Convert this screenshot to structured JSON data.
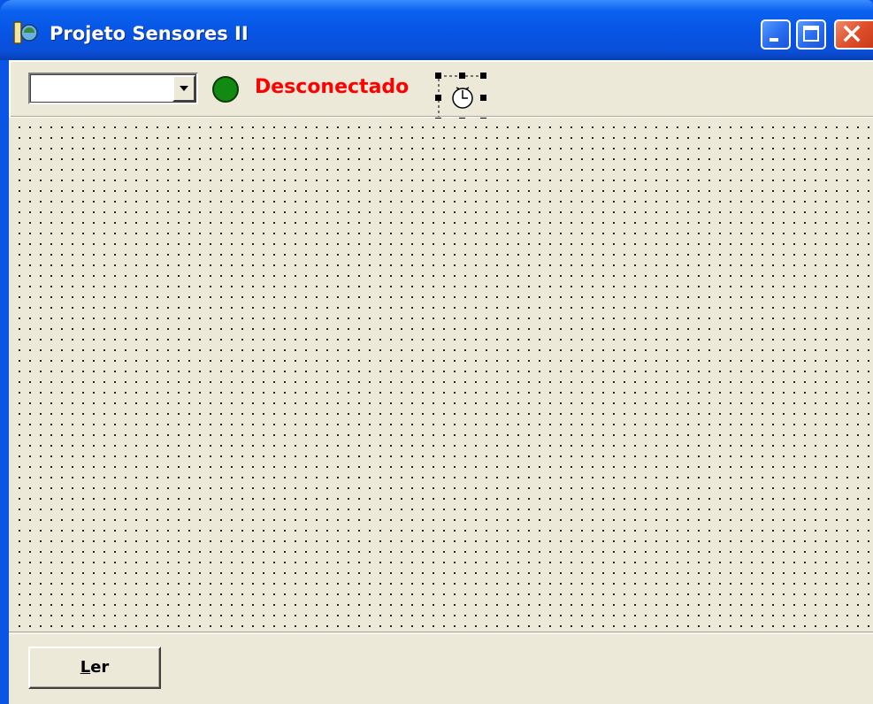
{
  "window": {
    "title": "Projeto Sensores II",
    "app_icon": "delphi-app-icon",
    "controls": [
      "minimize-icon",
      "maximize-icon",
      "close-icon"
    ]
  },
  "toolbar": {
    "port_select": {
      "value": "",
      "icon": "chevron-down-icon"
    },
    "led": {
      "color": "#128a12"
    },
    "status_text": "Desconectado",
    "status_color": "#ff0000",
    "timer_component": {
      "icon": "clock-icon",
      "selected": true
    }
  },
  "form_canvas": {
    "grid": true
  },
  "footer": {
    "read_button": {
      "label_underlined": "L",
      "label_rest": "er"
    }
  },
  "colors": {
    "titlebar": "#0754e4",
    "face": "#ece9d8",
    "close": "#e0502c"
  }
}
